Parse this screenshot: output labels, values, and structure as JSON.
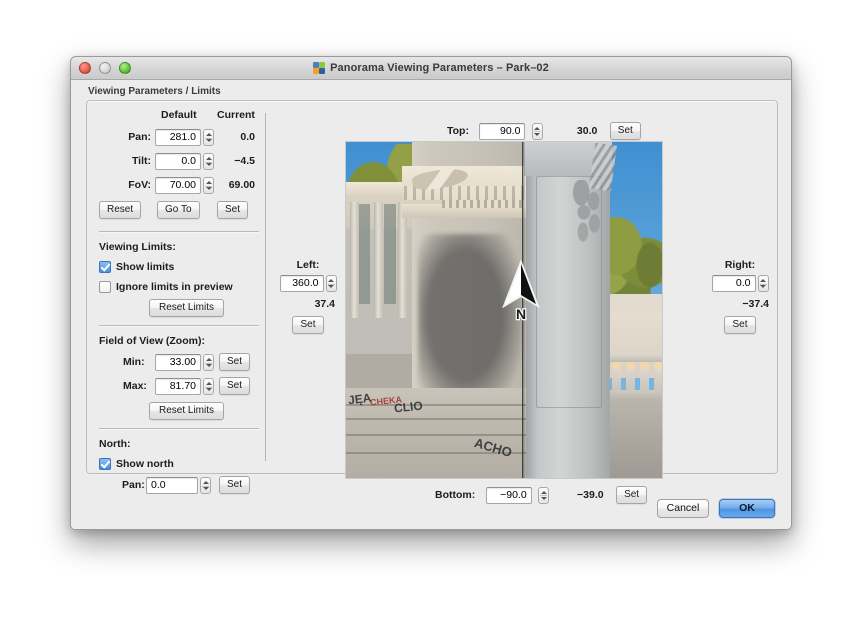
{
  "window": {
    "title": "Panorama Viewing Parameters – Park–02",
    "app_icon": "panorama-app-icon",
    "traffic_lights": {
      "close": "close-button",
      "minimize": "minimize-button",
      "zoom": "zoom-button"
    }
  },
  "group": {
    "label": "Viewing Parameters / Limits"
  },
  "params": {
    "col_default": "Default",
    "col_current": "Current",
    "rows": [
      {
        "name": "Pan:",
        "default": "281.0",
        "current": "0.0"
      },
      {
        "name": "Tilt:",
        "default": "0.0",
        "current": "−4.5"
      },
      {
        "name": "FoV:",
        "default": "70.00",
        "current": "69.00"
      }
    ],
    "buttons": {
      "reset": "Reset",
      "go_to": "Go To",
      "set": "Set"
    }
  },
  "viewing_limits": {
    "title": "Viewing Limits:",
    "show_limits": {
      "label": "Show limits",
      "checked": true
    },
    "ignore_limits": {
      "label": "Ignore limits in preview",
      "checked": false
    },
    "reset_limits": "Reset Limits"
  },
  "fov": {
    "title": "Field of View (Zoom):",
    "min": {
      "label": "Min:",
      "value": "33.00",
      "set": "Set"
    },
    "max": {
      "label": "Max:",
      "value": "81.70",
      "set": "Set"
    },
    "reset_limits": "Reset Limits"
  },
  "north": {
    "title": "North:",
    "show_north": {
      "label": "Show north",
      "checked": true
    },
    "pan": {
      "label": "Pan:",
      "value": "0.0",
      "set": "Set"
    }
  },
  "limits": {
    "top": {
      "label": "Top:",
      "value": "90.0",
      "current": "30.0",
      "set": "Set"
    },
    "bottom": {
      "label": "Bottom:",
      "value": "−90.0",
      "current": "−39.0",
      "set": "Set"
    },
    "left": {
      "label": "Left:",
      "value": "360.0",
      "current": "37.4",
      "set": "Set"
    },
    "right": {
      "label": "Right:",
      "value": "0.0",
      "current": "−37.4",
      "set": "Set"
    }
  },
  "preview": {
    "description": "Panorama preview of a stone monument with carved pillars, balustrade, trees and blue sky",
    "north_marker": "N",
    "graffiti": [
      "JĘA",
      "CHEKA",
      "CLIO",
      "ACHO"
    ]
  },
  "footer": {
    "cancel": "Cancel",
    "ok": "OK"
  },
  "colors": {
    "window_bg": "#ececec",
    "accent_blue": "#4e95e2",
    "checkbox_blue": "#4a8fdc",
    "sky": "#62a8de"
  }
}
